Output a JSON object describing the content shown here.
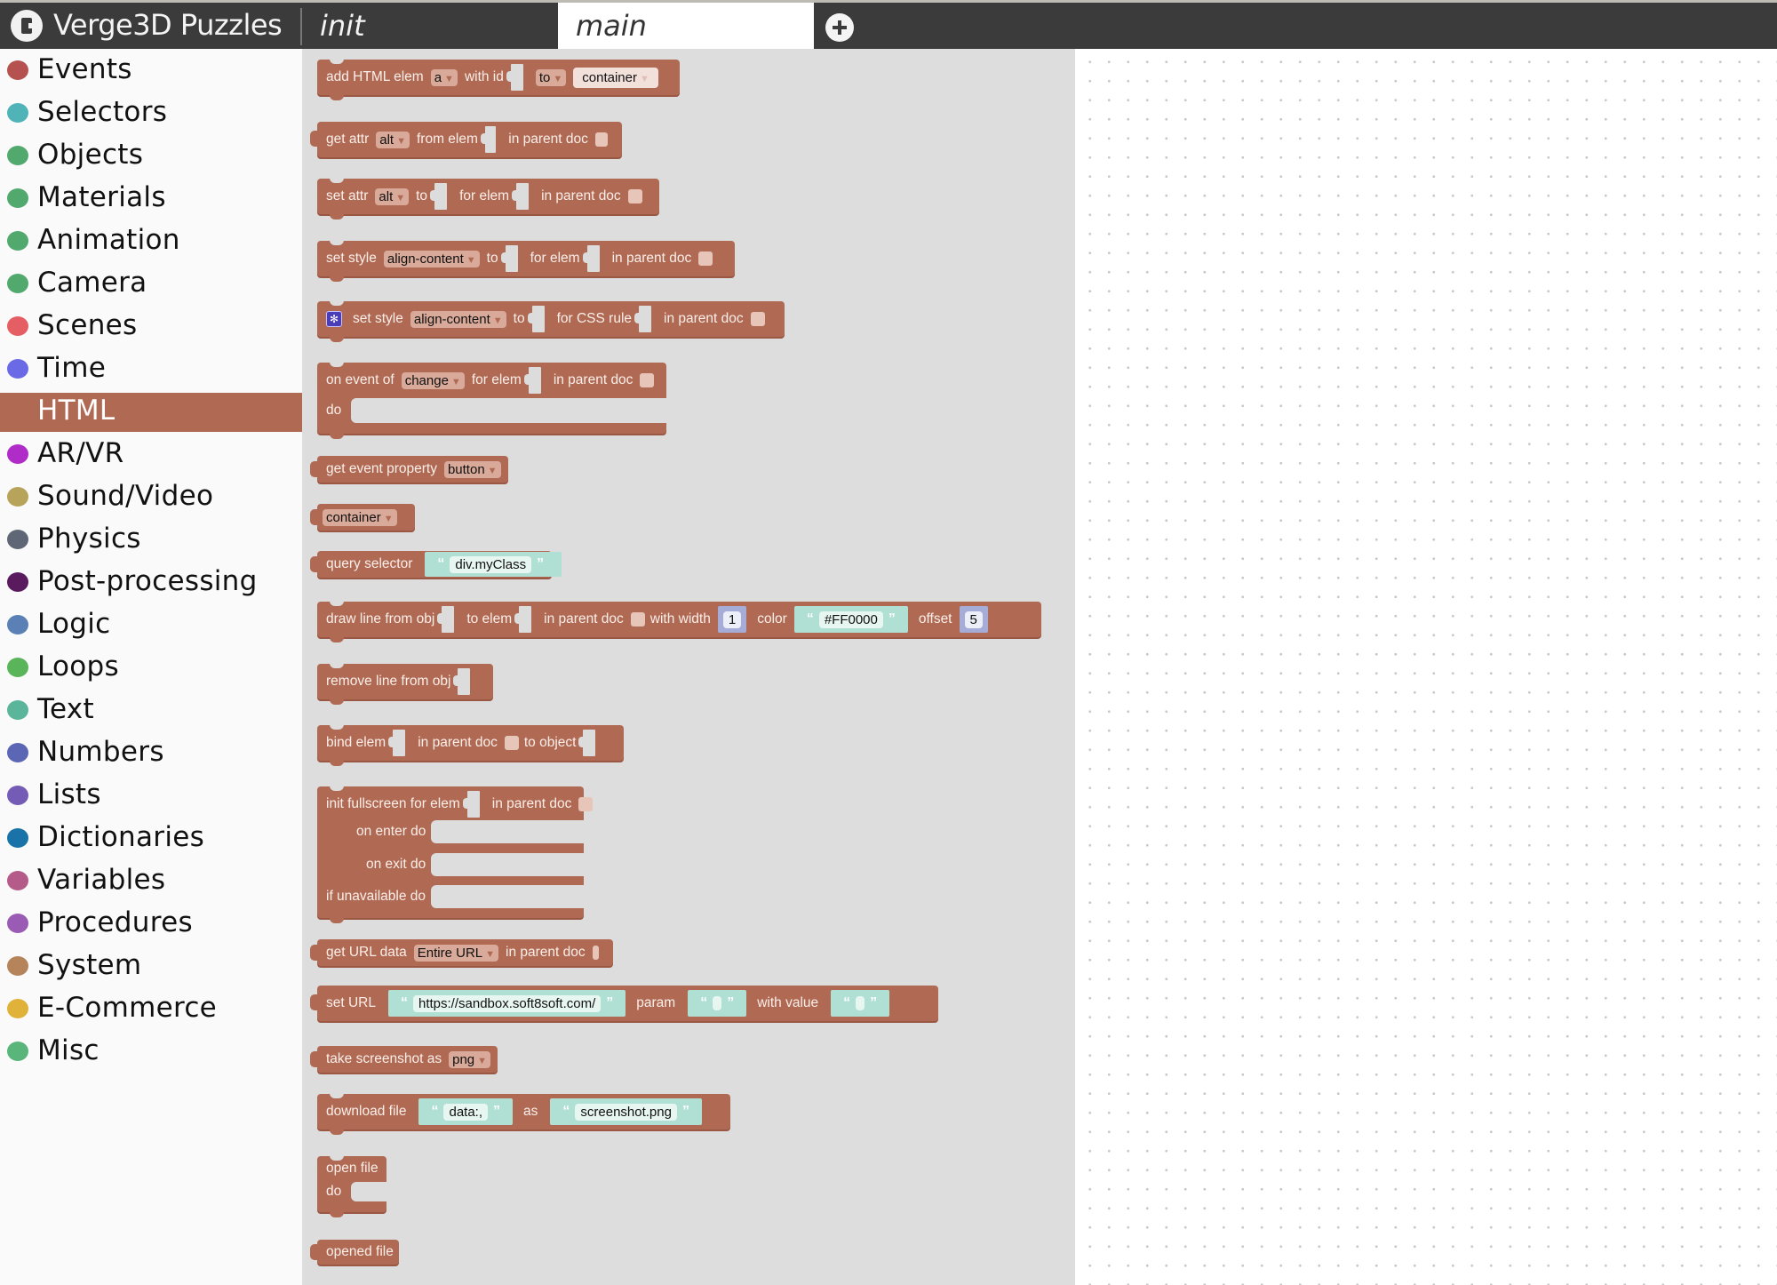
{
  "header": {
    "app_title": "Verge3D Puzzles",
    "logo_icon": "verge3d-logo",
    "tabs": [
      {
        "label": "init",
        "active": false
      },
      {
        "label": "main",
        "active": true
      }
    ],
    "add_tab_icon": "plus-circle-icon"
  },
  "sidebar": {
    "active": "HTML",
    "categories": [
      {
        "label": "Events",
        "color": "#b5524f"
      },
      {
        "label": "Selectors",
        "color": "#4fb3b7"
      },
      {
        "label": "Objects",
        "color": "#52a96e"
      },
      {
        "label": "Materials",
        "color": "#52a96e"
      },
      {
        "label": "Animation",
        "color": "#52a96e"
      },
      {
        "label": "Camera",
        "color": "#52a96e"
      },
      {
        "label": "Scenes",
        "color": "#e55e63"
      },
      {
        "label": "Time",
        "color": "#6a6ae6"
      },
      {
        "label": "HTML",
        "color": "#b06a54"
      },
      {
        "label": "AR/VR",
        "color": "#b02cc8"
      },
      {
        "label": "Sound/Video",
        "color": "#b8a35a"
      },
      {
        "label": "Physics",
        "color": "#5f6675"
      },
      {
        "label": "Post-processing",
        "color": "#5a1a5e"
      },
      {
        "label": "Logic",
        "color": "#5b80b5"
      },
      {
        "label": "Loops",
        "color": "#5ab55a"
      },
      {
        "label": "Text",
        "color": "#5ab59a"
      },
      {
        "label": "Numbers",
        "color": "#5b67b5"
      },
      {
        "label": "Lists",
        "color": "#745bb5"
      },
      {
        "label": "Dictionaries",
        "color": "#1a73a8"
      },
      {
        "label": "Variables",
        "color": "#b55b8a"
      },
      {
        "label": "Procedures",
        "color": "#9a5bb5"
      },
      {
        "label": "System",
        "color": "#b5845b"
      },
      {
        "label": "E-Commerce",
        "color": "#e0b23a"
      },
      {
        "label": "Misc",
        "color": "#5ab57a"
      }
    ]
  },
  "colors": {
    "html_block": "#b06a54",
    "text_block": "#b0e0d3",
    "number_block": "#a6acd8",
    "flyout_bg": "#dddddd",
    "topbar": "#3b3b3b"
  },
  "blocks": {
    "add_html_elem": {
      "t1": "add HTML elem",
      "dd1": "a",
      "t2": "with id",
      "dd2": "to",
      "dd3": "container"
    },
    "get_attr": {
      "t1": "get attr",
      "dd1": "alt",
      "t2": "from elem",
      "t3": "in parent doc"
    },
    "set_attr": {
      "t1": "set attr",
      "dd1": "alt",
      "t2": "to",
      "t3": "for elem",
      "t4": "in parent doc"
    },
    "set_style": {
      "t1": "set style",
      "dd1": "align-content",
      "t2": "to",
      "t3": "for elem",
      "t4": "in parent doc"
    },
    "set_style_css": {
      "t1": "set style",
      "dd1": "align-content",
      "t2": "to",
      "t3": "for CSS rule",
      "t4": "in parent doc",
      "gear_icon": "gear-icon"
    },
    "on_event": {
      "t1": "on event of",
      "dd1": "change",
      "t2": "for elem",
      "t3": "in parent doc",
      "do": "do"
    },
    "get_event_property": {
      "t1": "get event property",
      "dd1": "button"
    },
    "container": {
      "dd1": "container"
    },
    "query_selector": {
      "t1": "query selector",
      "str": "div.myClass"
    },
    "draw_line": {
      "t1": "draw line from obj",
      "t2": "to elem",
      "t3": "in parent doc",
      "t4": "with width",
      "width": "1",
      "t5": "color",
      "color": "#FF0000",
      "t6": "offset",
      "offset": "5"
    },
    "remove_line": {
      "t1": "remove line from obj"
    },
    "bind_elem": {
      "t1": "bind elem",
      "t2": "in parent doc",
      "t3": "to object"
    },
    "init_fullscreen": {
      "t1": "init fullscreen for elem",
      "t2": "in parent doc",
      "enter": "on enter do",
      "exit": "on exit do",
      "unavail": "if unavailable do"
    },
    "get_url_data": {
      "t1": "get URL data",
      "dd1": "Entire URL",
      "t2": "in parent doc"
    },
    "set_url": {
      "t1": "set URL",
      "url": "https://sandbox.soft8soft.com/",
      "t2": "param",
      "t3": "with value"
    },
    "take_screenshot": {
      "t1": "take screenshot as",
      "dd1": "png"
    },
    "download_file": {
      "t1": "download file",
      "data": "data:,",
      "t2": "as",
      "name": "screenshot.png"
    },
    "open_file": {
      "t1": "open file",
      "do": "do"
    },
    "opened_file": {
      "t1": "opened file"
    }
  }
}
